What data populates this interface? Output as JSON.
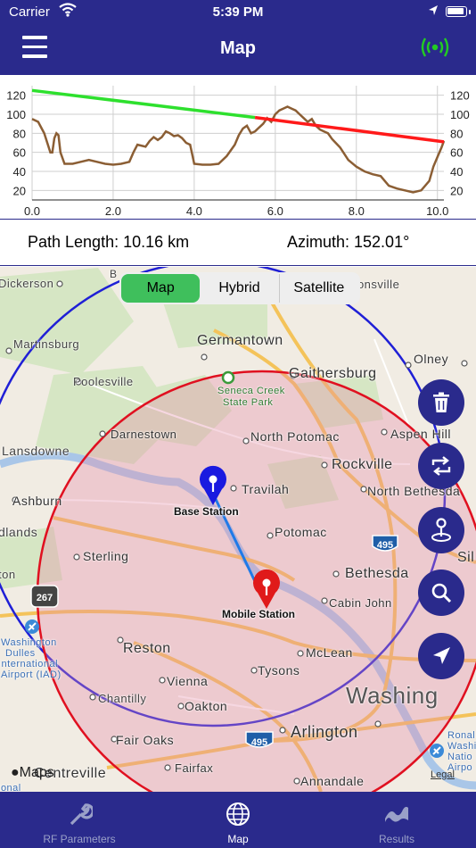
{
  "status_bar": {
    "carrier": "Carrier",
    "time": "5:39 PM"
  },
  "header": {
    "title": "Map"
  },
  "colors": {
    "navy": "#2a2a8c",
    "accent_green": "#3fbf5c",
    "profile": "#8b5e34",
    "clear_line": "#2ee02e",
    "blocked_line": "#ff1a1a",
    "signal_icon": "#22cc22"
  },
  "chart_data": {
    "type": "line",
    "xlim": [
      0,
      10.16
    ],
    "ylim": [
      10,
      130
    ],
    "x_ticks": [
      "0.0",
      "2.0",
      "4.0",
      "6.0",
      "8.0",
      "10.0"
    ],
    "y_ticks": [
      "20",
      "40",
      "60",
      "80",
      "100",
      "120"
    ],
    "series": [
      {
        "role": "terrain",
        "color": "#8b5e34",
        "x": [
          0,
          0.15,
          0.3,
          0.45,
          0.5,
          0.55,
          0.6,
          0.65,
          0.7,
          0.8,
          1.0,
          1.2,
          1.4,
          1.6,
          1.8,
          2.0,
          2.2,
          2.4,
          2.5,
          2.6,
          2.8,
          2.9,
          3.0,
          3.1,
          3.2,
          3.3,
          3.4,
          3.5,
          3.6,
          3.7,
          3.8,
          3.9,
          4.0,
          4.2,
          4.4,
          4.6,
          4.8,
          5.0,
          5.1,
          5.2,
          5.3,
          5.4,
          5.5,
          5.6,
          5.7,
          5.8,
          5.9,
          6.0,
          6.1,
          6.2,
          6.3,
          6.4,
          6.5,
          6.6,
          6.7,
          6.8,
          6.9,
          7.0,
          7.1,
          7.2,
          7.3,
          7.4,
          7.6,
          7.8,
          8.0,
          8.2,
          8.4,
          8.6,
          8.8,
          9.0,
          9.2,
          9.4,
          9.6,
          9.8,
          9.9,
          10.0,
          10.1,
          10.16
        ],
        "y": [
          95,
          92,
          80,
          60,
          60,
          75,
          80,
          78,
          60,
          48,
          48,
          50,
          52,
          50,
          48,
          47,
          48,
          50,
          60,
          68,
          66,
          72,
          76,
          73,
          76,
          82,
          80,
          77,
          78,
          75,
          70,
          68,
          48,
          47,
          47,
          48,
          56,
          68,
          78,
          85,
          88,
          80,
          82,
          86,
          90,
          96,
          92,
          100,
          104,
          106,
          108,
          106,
          104,
          100,
          96,
          92,
          95,
          88,
          84,
          82,
          80,
          74,
          65,
          52,
          45,
          40,
          37,
          35,
          25,
          22,
          20,
          18,
          20,
          30,
          45,
          55,
          65,
          72
        ]
      },
      {
        "role": "line-of-sight-clear",
        "color": "#2ee02e",
        "x": [
          0,
          5.5
        ],
        "y": [
          125,
          96.6
        ]
      },
      {
        "role": "line-of-sight-obstructed",
        "color": "#ff1a1a",
        "x": [
          5.5,
          10.16
        ],
        "y": [
          96.6,
          71
        ]
      }
    ]
  },
  "info": {
    "path_length": "Path Length: 10.16 km",
    "azimuth": "Azimuth: 152.01°"
  },
  "map_type": {
    "options": [
      "Map",
      "Hybrid",
      "Satellite"
    ],
    "selected": "Map"
  },
  "map_labels": [
    {
      "text": "Dickerson",
      "name": "label-dickerson"
    },
    {
      "text": "Germantown",
      "name": "label-germantown"
    },
    {
      "text": "Martinsburg",
      "name": "label-martinsburg"
    },
    {
      "text": "Olney",
      "name": "label-olney"
    },
    {
      "text": "Poolesville",
      "name": "label-poolesville"
    },
    {
      "text": "Gaithersburg",
      "name": "label-gaithersburg"
    },
    {
      "text": "Seneca Creek",
      "name": "label-seneca-creek"
    },
    {
      "text": "State Park",
      "name": "label-state-park"
    },
    {
      "text": "Darnestown",
      "name": "label-darnestown"
    },
    {
      "text": "North Potomac",
      "name": "label-north-potomac"
    },
    {
      "text": "Aspen Hill",
      "name": "label-aspen-hill"
    },
    {
      "text": "Lansdowne",
      "name": "label-lansdowne"
    },
    {
      "text": "Rockville",
      "name": "label-rockville"
    },
    {
      "text": "Travilah",
      "name": "label-travilah"
    },
    {
      "text": "North Bethesda",
      "name": "label-north-bethesda"
    },
    {
      "text": "Ashburn",
      "name": "label-ashburn"
    },
    {
      "text": "dlands",
      "name": "label-dlands"
    },
    {
      "text": "Potomac",
      "name": "label-potomac"
    },
    {
      "text": "Sterling",
      "name": "label-sterling"
    },
    {
      "text": "Bethesda",
      "name": "label-bethesda"
    },
    {
      "text": "ton",
      "name": "label-ton"
    },
    {
      "text": "Cabin John",
      "name": "label-cabin-john"
    },
    {
      "text": "Reston",
      "name": "label-reston"
    },
    {
      "text": "McLean",
      "name": "label-mclean"
    },
    {
      "text": "Washington",
      "name": "label-washington-dulles-1"
    },
    {
      "text": "Dulles",
      "name": "label-washington-dulles-2"
    },
    {
      "text": "International",
      "name": "label-washington-dulles-3"
    },
    {
      "text": "Airport (IAD)",
      "name": "label-washington-dulles-4"
    },
    {
      "text": "Tysons",
      "name": "label-tysons"
    },
    {
      "text": "Vienna",
      "name": "label-vienna"
    },
    {
      "text": "Chantilly",
      "name": "label-chantilly"
    },
    {
      "text": "Oakton",
      "name": "label-oakton"
    },
    {
      "text": "Washing",
      "name": "label-washing"
    },
    {
      "text": "Fair Oaks",
      "name": "label-fair-oaks"
    },
    {
      "text": "Arlington",
      "name": "label-arlington"
    },
    {
      "text": "Fairfax",
      "name": "label-fairfax"
    },
    {
      "text": "Annandale",
      "name": "label-annandale"
    },
    {
      "text": "Centreville",
      "name": "label-centreville"
    },
    {
      "text": "Ronal",
      "name": "label-ronal-1"
    },
    {
      "text": "Washi",
      "name": "label-ronal-2"
    },
    {
      "text": "Natio",
      "name": "label-ronal-3"
    },
    {
      "text": "Airpo",
      "name": "label-ronal-4"
    },
    {
      "text": "Sil",
      "name": "label-sil"
    },
    {
      "text": "rtonsville",
      "name": "label-burtonsville"
    },
    {
      "text": "B",
      "name": "label-b"
    },
    {
      "text": "ional",
      "name": "label-ional"
    }
  ],
  "shields": [
    {
      "text": "495",
      "name": "shield-495-north"
    },
    {
      "text": "495",
      "name": "shield-495-south"
    },
    {
      "text": "267",
      "name": "shield-267"
    }
  ],
  "markers": {
    "base": "Base Station",
    "mobile": "Mobile Station"
  },
  "map_attribution": {
    "brand": "Maps",
    "legal": "Legal"
  },
  "fab_icons": [
    "trash-icon",
    "swap-icon",
    "place-pin-icon",
    "search-icon",
    "navigation-arrow-icon"
  ],
  "tabs": [
    {
      "label": "RF Parameters",
      "icon": "wrench-icon",
      "selected": false
    },
    {
      "label": "Map",
      "icon": "globe-icon",
      "selected": true
    },
    {
      "label": "Results",
      "icon": "chart-line-icon",
      "selected": false
    }
  ]
}
